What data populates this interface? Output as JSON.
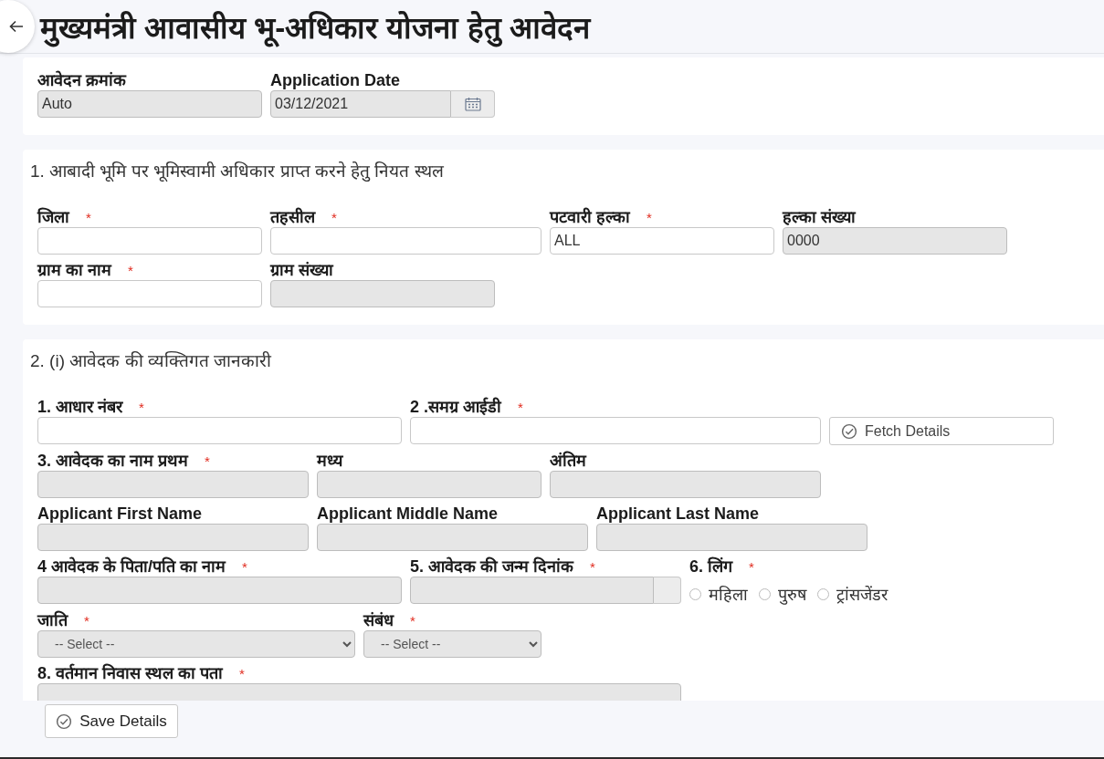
{
  "header": {
    "title": "मुख्यमंत्री आवासीय भू-अधिकार योजना हेतु आवेदन"
  },
  "sections": [
    {
      "rows": [
        [
          {
            "kind": "text",
            "label": "आवेदन क्रमांक",
            "value": "Auto",
            "disabled": true
          },
          {
            "kind": "date",
            "label": "Application Date",
            "value": "03/12/2021",
            "disabled": true
          }
        ]
      ]
    },
    {
      "title": "1. आबादी भूमि पर भूमिस्वामी अधिकार प्राप्त करने हेतु नियत स्थल",
      "rows": [
        [
          {
            "kind": "text",
            "label": "जिला",
            "mark": "*",
            "disabled": false
          },
          {
            "kind": "text",
            "label": "तहसील",
            "mark": "*",
            "disabled": false
          },
          {
            "kind": "text",
            "label": "पटवारी हल्का",
            "mark": "*",
            "value": "ALL",
            "disabled": false
          },
          {
            "kind": "text",
            "label": "हल्का संख्या",
            "value": "0000",
            "disabled": true
          }
        ],
        [
          {
            "kind": "text",
            "label": "ग्राम का नाम",
            "mark": "*",
            "disabled": false
          },
          {
            "kind": "text",
            "label": "ग्राम संख्या",
            "disabled": true
          }
        ]
      ]
    },
    {
      "title": "2. (i) आवेदक की व्यक्तिगत जानकारी",
      "rows": [
        [
          {
            "kind": "text",
            "label": "1. आधार नंबर",
            "mark": "*",
            "disabled": false
          },
          {
            "kind": "text",
            "label": "2 .समग्र आईडी",
            "mark": "*",
            "disabled": false
          },
          {
            "kind": "button",
            "label": "Fetch Details"
          }
        ],
        [
          {
            "kind": "text",
            "label": "3. आवेदक का नाम प्रथम",
            "mark": "*",
            "disabled": true
          },
          {
            "kind": "text",
            "label": "मध्य",
            "disabled": true
          },
          {
            "kind": "text",
            "label": "अंतिम",
            "disabled": true
          }
        ],
        [
          {
            "kind": "text",
            "label": "Applicant First Name",
            "disabled": true
          },
          {
            "kind": "text",
            "label": "Applicant Middle Name",
            "disabled": true
          },
          {
            "kind": "text",
            "label": "Applicant Last Name",
            "disabled": true
          }
        ],
        [
          {
            "kind": "text",
            "label": "4 आवेदक के पिता/पति का नाम",
            "mark": "*",
            "disabled": true
          },
          {
            "kind": "date",
            "label": "5. आवेदक की जन्म दिनांक",
            "mark": "*",
            "disabled": true
          },
          {
            "kind": "radio",
            "label": "6. लिंग",
            "mark": "*",
            "options": [
              {
                "label": "महिला",
                "selected": false
              },
              {
                "label": "पुरुष",
                "selected": false
              },
              {
                "label": "ट्रांसजेंडर",
                "selected": false
              }
            ]
          }
        ],
        [
          {
            "kind": "select",
            "label": "जाति",
            "mark": "*",
            "value": "-- Select --",
            "disabled": true
          },
          {
            "kind": "select",
            "label": "संबंध",
            "mark": "*",
            "value": "-- Select --",
            "disabled": true
          }
        ],
        [
          {
            "kind": "text",
            "label": "8. वर्तमान निवास स्थल का पता",
            "mark": "*",
            "disabled": true
          }
        ]
      ]
    }
  ],
  "footer": {
    "save_button": "Save Details"
  }
}
